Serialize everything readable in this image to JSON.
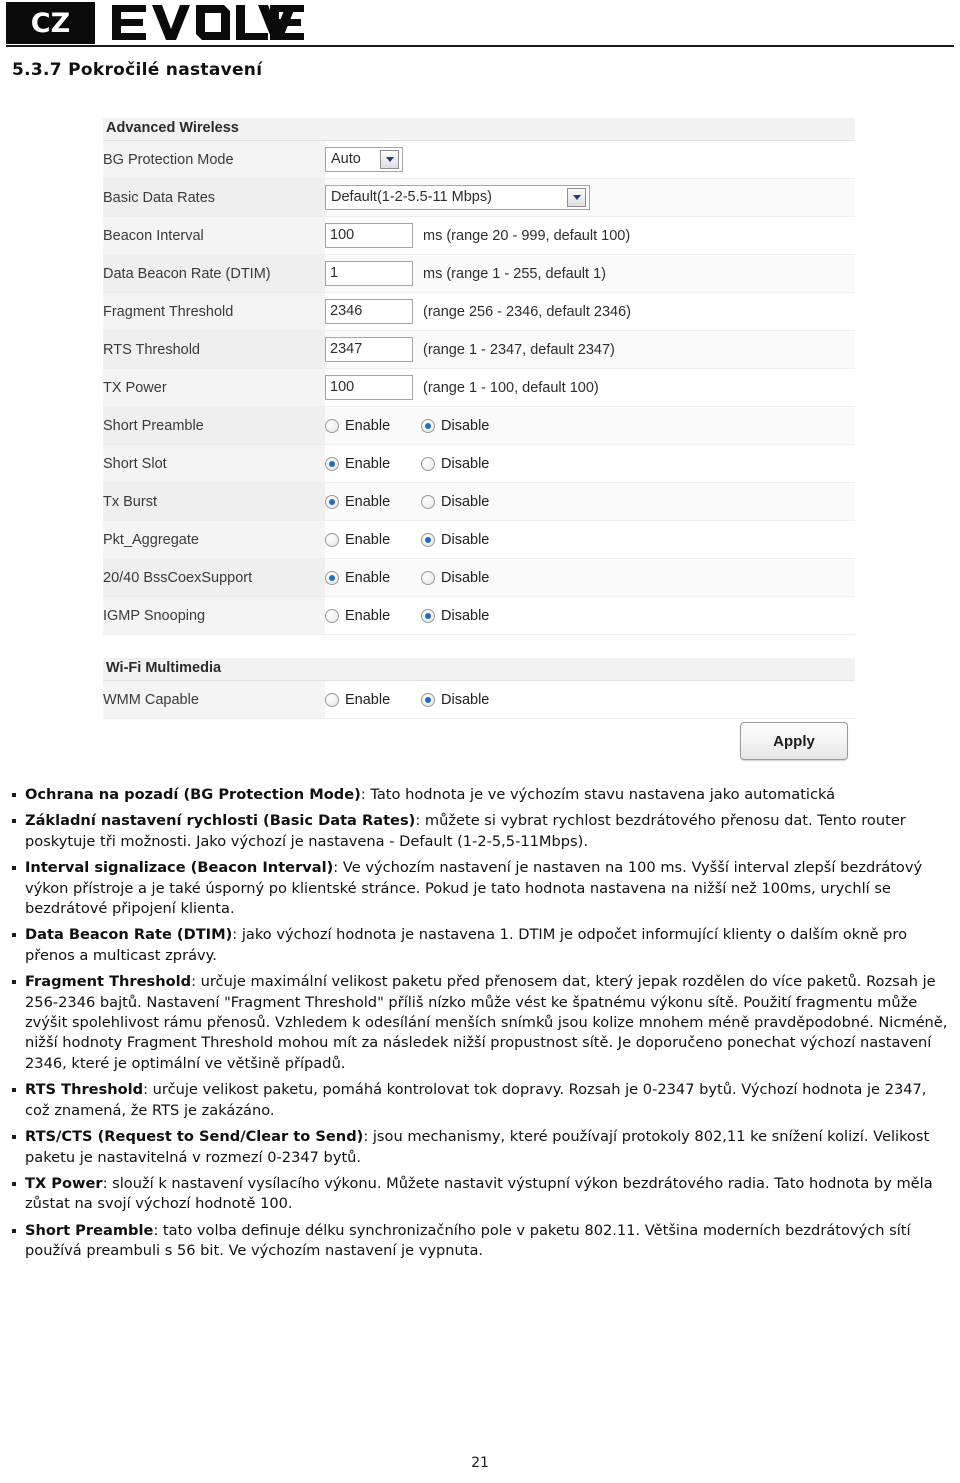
{
  "header": {
    "country_badge": "CZ",
    "brand": "EVOLVE"
  },
  "section": {
    "title": "5.3.7 Pokročilé nastavení"
  },
  "router_ui": {
    "panel_title": "Advanced Wireless",
    "rows": [
      {
        "label": "BG Protection Mode",
        "control": "select",
        "value": "Auto"
      },
      {
        "label": "Basic Data Rates",
        "control": "select",
        "value": "Default(1-2-5.5-11 Mbps)"
      },
      {
        "label": "Beacon Interval",
        "control": "text",
        "value": "100",
        "hint": "ms (range 20 - 999, default 100)"
      },
      {
        "label": "Data Beacon Rate (DTIM)",
        "control": "text",
        "value": "1",
        "hint": "ms (range 1 - 255, default 1)"
      },
      {
        "label": "Fragment Threshold",
        "control": "text",
        "value": "2346",
        "hint": "(range 256 - 2346, default 2346)"
      },
      {
        "label": "RTS Threshold",
        "control": "text",
        "value": "2347",
        "hint": "(range 1 - 2347, default 2347)"
      },
      {
        "label": "TX Power",
        "control": "text",
        "value": "100",
        "hint": "(range 1 - 100, default 100)"
      },
      {
        "label": "Short Preamble",
        "control": "radio",
        "enable_label": "Enable",
        "disable_label": "Disable",
        "selected": "Disable"
      },
      {
        "label": "Short Slot",
        "control": "radio",
        "enable_label": "Enable",
        "disable_label": "Disable",
        "selected": "Enable"
      },
      {
        "label": "Tx Burst",
        "control": "radio",
        "enable_label": "Enable",
        "disable_label": "Disable",
        "selected": "Enable"
      },
      {
        "label": "Pkt_Aggregate",
        "control": "radio",
        "enable_label": "Enable",
        "disable_label": "Disable",
        "selected": "Disable"
      },
      {
        "label": "20/40 BssCoexSupport",
        "control": "radio",
        "enable_label": "Enable",
        "disable_label": "Disable",
        "selected": "Enable"
      },
      {
        "label": "IGMP Snooping",
        "control": "radio",
        "enable_label": "Enable",
        "disable_label": "Disable",
        "selected": "Disable"
      }
    ],
    "wmm_panel_title": "Wi-Fi Multimedia",
    "wmm_row": {
      "label": "WMM Capable",
      "control": "radio",
      "enable_label": "Enable",
      "disable_label": "Disable",
      "selected": "Disable"
    },
    "apply_label": "Apply"
  },
  "description": {
    "items": [
      {
        "bold": "Ochrana na pozadí (BG Protection Mode)",
        "rest": ": Tato hodnota je ve výchozím stavu nastavena jako automatická"
      },
      {
        "bold": "Základní nastavení rychlosti (Basic Data Rates)",
        "rest": ": můžete si vybrat rychlost bezdrátového přenosu dat. Tento router poskytuje tři možnosti. Jako výchozí je nastavena - Default (1-2-5,5-11Mbps)."
      },
      {
        "bold": "Interval signalizace (Beacon Interval)",
        "rest": ": Ve výchozím nastavení je nastaven na 100 ms. Vyšší interval zlepší bezdrátový výkon přístroje a je také úsporný po klientské stránce. Pokud je tato hodnota nastavena na nižší než 100ms, urychlí se bezdrátové připojení klienta."
      },
      {
        "bold": "Data Beacon Rate (DTIM)",
        "rest": ": jako výchozí hodnota je nastavena 1. DTIM je odpočet informující klienty o dalším okně pro přenos a multicast zprávy."
      },
      {
        "bold": "Fragment Threshold",
        "rest": ": určuje maximální velikost paketu před přenosem dat, který jepak rozdělen do více paketů. Rozsah je 256-2346 bajtů. Nastavení \"Fragment Threshold\" příliš nízko může vést ke špatnému výkonu sítě. Použití fragmentu může zvýšit spolehlivost rámu přenosů. Vzhledem k odesílání menších snímků jsou kolize mnohem méně pravděpodobné. Nicméně, nižší hodnoty Fragment Threshold mohou mít za následek nižší propustnost sítě. Je doporučeno ponechat výchozí nastavení 2346, které je optimální ve většině případů."
      },
      {
        "bold": "RTS Threshold",
        "rest": ": určuje velikost paketu, pomáhá kontrolovat tok dopravy. Rozsah je 0-2347 bytů. Výchozí hodnota je 2347, což znamená, že RTS je zakázáno."
      },
      {
        "bold": "RTS/CTS (Request to Send/Clear to Send)",
        "rest": ": jsou mechanismy, které používají protokoly 802,11 ke snížení kolizí. Velikost paketu je nastavitelná v rozmezí 0-2347 bytů."
      },
      {
        "bold": "TX Power",
        "rest": ": slouží k nastavení vysílacího výkonu. Můžete nastavit výstupní výkon bezdrátového radia. Tato hodnota by měla zůstat na svojí výchozí hodnotě 100."
      },
      {
        "bold": "Short Preamble",
        "rest": ": tato volba definuje délku synchronizačního pole v paketu 802.11. Většina moderních bezdrátových sítí používá preambuli s 56 bit. Ve výchozím nastavení je vypnuta."
      }
    ]
  },
  "footer": {
    "page_number": "21"
  }
}
